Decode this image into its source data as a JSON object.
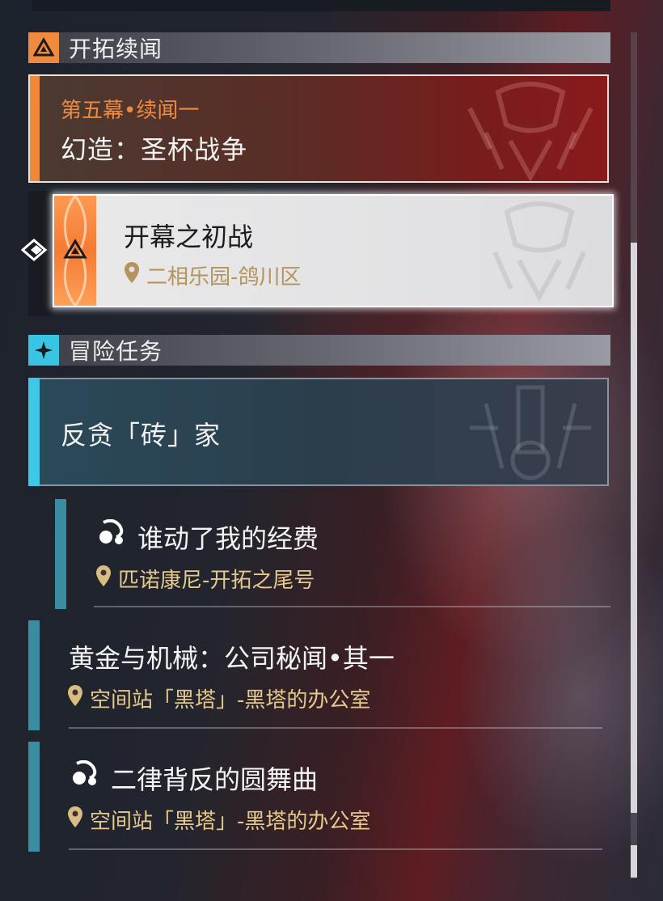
{
  "sections": {
    "trailblaze": {
      "title": "开拓续闻"
    },
    "adventure": {
      "title": "冒险任务"
    }
  },
  "trailblaze_quest": {
    "chapter": "第五幕•续闻一",
    "title": "幻造：圣杯战争"
  },
  "selected_subquest": {
    "name": "开幕之初战",
    "location": "二相乐园-鸽川区"
  },
  "adventure_quest": {
    "title": "反贪「砖」家"
  },
  "subquests": [
    {
      "name": "谁动了我的经费",
      "location": "匹诺康尼-开拓之尾号",
      "icon": "dialog-icon"
    },
    {
      "name": "黄金与机械：公司秘闻•其一",
      "location": "空间站「黑塔」-黑塔的办公室"
    },
    {
      "name": "二律背反的圆舞曲",
      "location": "空间站「黑塔」-黑塔的办公室",
      "icon": "dialog-icon"
    }
  ],
  "colors": {
    "trailblaze_accent": "#f08a3c",
    "adventure_accent": "#39c4e4",
    "location_text": "#e5c98c"
  }
}
